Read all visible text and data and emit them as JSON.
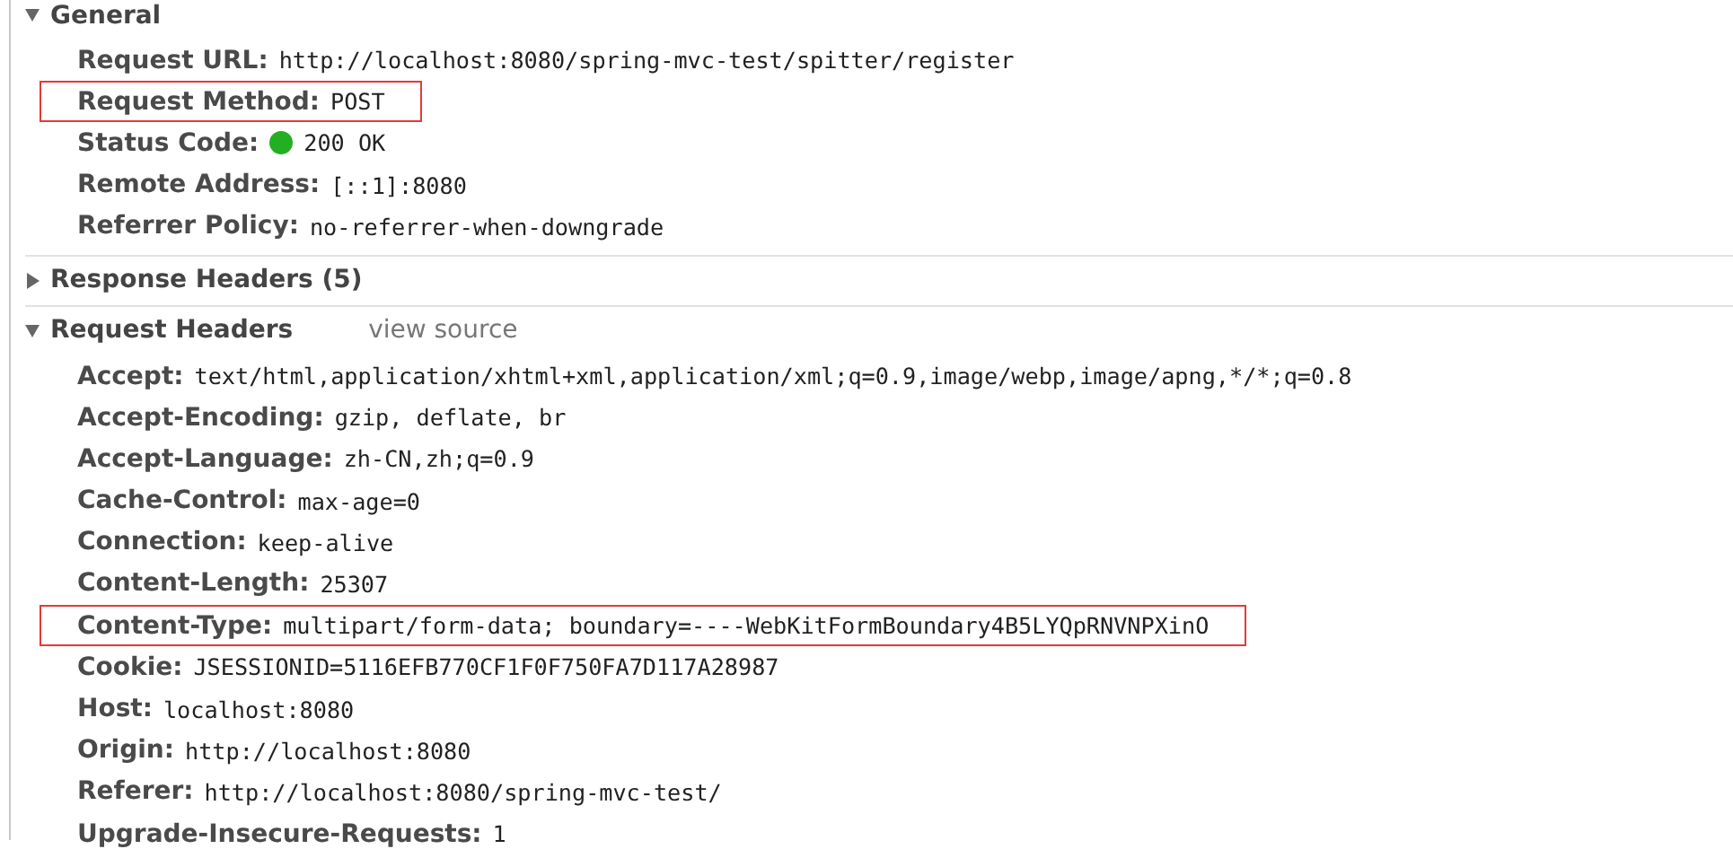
{
  "sections": [
    {
      "title": "General",
      "expanded": true,
      "rows": [
        {
          "key": "Request URL:",
          "value": "http://localhost:8080/spring-mvc-test/spitter/register",
          "highlighted": false
        },
        {
          "key": "Request Method:",
          "value": "POST",
          "highlighted": true
        },
        {
          "key": "Status Code:",
          "value": "200 OK",
          "color": "#22b022",
          "highlighted": false
        },
        {
          "key": "Remote Address:",
          "value": "[::1]:8080",
          "highlighted": false
        },
        {
          "key": "Referrer Policy:",
          "value": "no-referrer-when-downgrade",
          "highlighted": false
        }
      ]
    },
    {
      "title": "Response Headers (5)",
      "expanded": false
    },
    {
      "title": "Request Headers",
      "expanded": true,
      "link": "view source",
      "rows": [
        {
          "key": "Accept:",
          "value": "text/html,application/xhtml+xml,application/xml;q=0.9,image/webp,image/apng,*/*;q=0.8",
          "highlighted": false
        },
        {
          "key": "Accept-Encoding:",
          "value": "gzip, deflate, br",
          "highlighted": false
        },
        {
          "key": "Accept-Language:",
          "value": "zh-CN,zh;q=0.9",
          "highlighted": false
        },
        {
          "key": "Cache-Control:",
          "value": "max-age=0",
          "highlighted": false
        },
        {
          "key": "Connection:",
          "value": "keep-alive",
          "highlighted": false
        },
        {
          "key": "Content-Length:",
          "value": "25307",
          "highlighted": false
        },
        {
          "key": "Content-Type:",
          "value": "multipart/form-data; boundary=----WebKitFormBoundary4B5LYQpRNVNPXinO",
          "highlighted": true
        },
        {
          "key": "Cookie:",
          "value": "JSESSIONID=5116EFB770CF1F0F750FA7D117A28987",
          "highlighted": false
        },
        {
          "key": "Host:",
          "value": "localhost:8080",
          "highlighted": false
        },
        {
          "key": "Origin:",
          "value": "http://localhost:8080",
          "highlighted": false
        },
        {
          "key": "Referer:",
          "value": "http://localhost:8080/spring-mvc-test/",
          "highlighted": false
        },
        {
          "key": "Upgrade-Insecure-Requests:",
          "value": "1",
          "highlighted": false
        }
      ]
    }
  ]
}
